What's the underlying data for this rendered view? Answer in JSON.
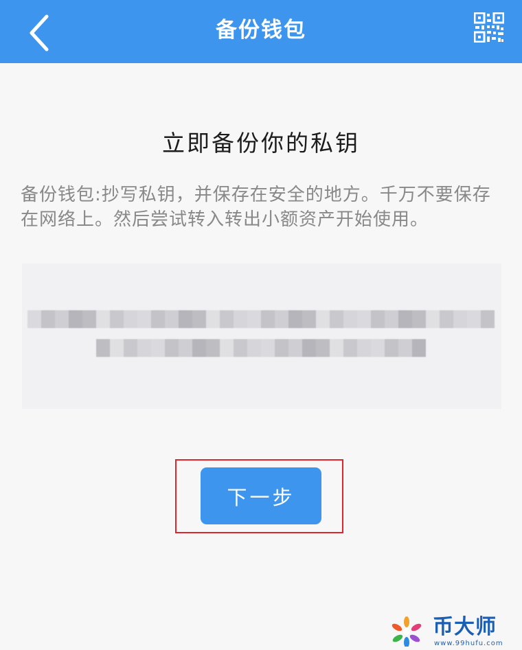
{
  "header": {
    "title": "备份钱包",
    "back_icon": "chevron-left-icon",
    "qr_icon": "qr-code-icon",
    "background_color": "#3d95ee"
  },
  "main": {
    "heading": "立即备份你的私钥",
    "description": "备份钱包:抄写私钥，并保存在安全的地方。千万不要保存在网络上。然后尝试转入转出小额资产开始使用。"
  },
  "private_key": {
    "state": "pixelated-hidden"
  },
  "actions": {
    "next_label": "下一步",
    "button_color": "#3d95ee",
    "highlight_color": "#e0242b"
  },
  "watermark": {
    "name": "币大师",
    "url": "www.99hufu.com"
  }
}
